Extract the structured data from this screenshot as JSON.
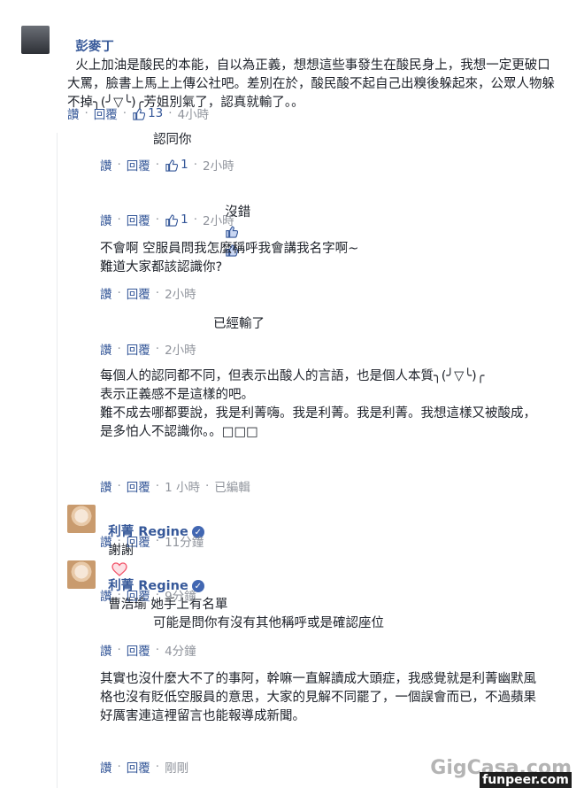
{
  "comment": {
    "author": "彭麥丁",
    "text": "火上加油是酸民的本能，自以為正義，想想這些事發生在酸民身上，我想一定更破口大罵，臉書上馬上上傳公社吧。差別在於，酸民酸不起自己出糗後躲起來，公眾人物躲不掉╮(╯▽╰)╭芳姐別氣了，認真就輸了。。",
    "actions": {
      "like": "讚",
      "reply": "回覆",
      "like_count": "13",
      "time": "4小時"
    }
  },
  "replies": [
    {
      "text": "認同你",
      "like": "讚",
      "reply": "回覆",
      "like_count": "1",
      "time": "2小時"
    },
    {
      "text": "沒錯",
      "like": "讚",
      "reply": "回覆",
      "like_count": "1",
      "time": "2小時"
    },
    {
      "text": "不會啊 空服員問我怎麼稱呼我會講我名字啊~\n難道大家都該認識你?",
      "like": "讚",
      "reply": "回覆",
      "time": "2小時"
    },
    {
      "text": "已經輸了",
      "like": "讚",
      "reply": "回覆",
      "time": "2小時"
    },
    {
      "text": "每個人的認同都不同，但表示出酸人的言語，也是個人本質╮(╯▽╰)╭\n表示正義感不是這樣的吧。\n難不成去哪都要說，我是利菁嗨。我是利菁。我是利菁。我想這樣又被酸成，是多怕人不認識你。。□□□",
      "like": "讚",
      "reply": "回覆",
      "time": "1 小時",
      "edited": "已編輯"
    },
    {
      "author": "利菁 Regine",
      "text": "謝謝",
      "like": "讚",
      "reply": "回覆",
      "time": "11分鐘"
    },
    {
      "author": "利菁 Regine",
      "text": "曹浩瑜 她手上有名單",
      "like": "讚",
      "reply": "回覆",
      "time": "9分鐘"
    },
    {
      "text": "可能是問你有沒有其他稱呼或是確認座位",
      "like": "讚",
      "reply": "回覆",
      "time": "4分鐘"
    },
    {
      "text": "其實也沒什麼大不了的事阿，幹嘛一直解讀成大頭症，我感覺就是利菁幽默風格也沒有貶低空服員的意思，大家的見解不同罷了，一個誤會而已，不過蘋果好厲害連這裡留言也能報導成新聞。",
      "like": "讚",
      "reply": "回覆",
      "time": "剛剛"
    }
  ],
  "watermark": {
    "primary": "GigCasa.com",
    "secondary": "funpeer.com"
  },
  "colors": {
    "link": "#365899",
    "meta": "#90949c",
    "text": "#1d2129",
    "heart": "#f25268"
  },
  "icons": [
    "user-avatar",
    "like-thumb-icon",
    "verified-badge-icon",
    "heart-icon"
  ]
}
